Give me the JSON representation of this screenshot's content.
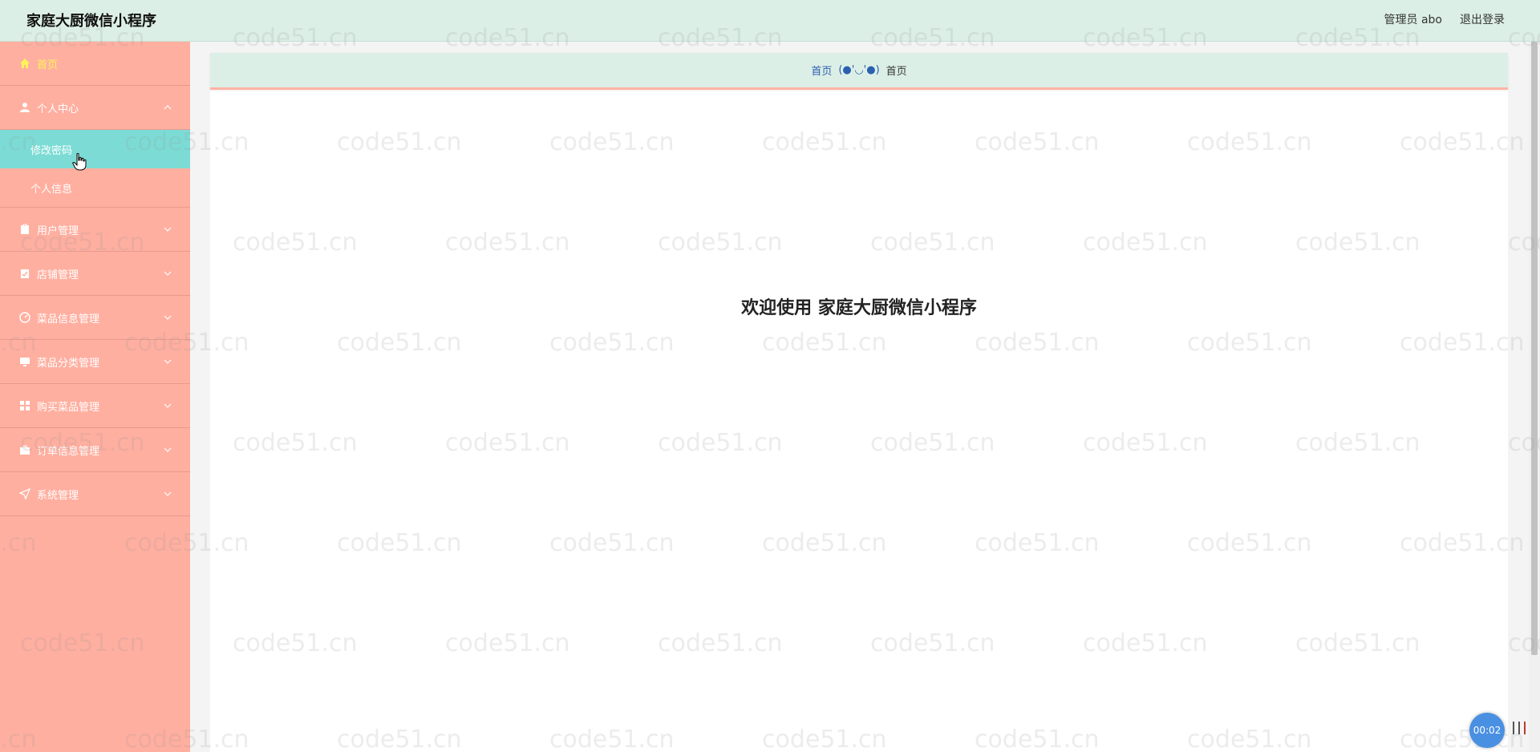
{
  "app": {
    "title": "家庭大厨微信小程序"
  },
  "header": {
    "user_label": "管理员 abo",
    "logout_label": "退出登录"
  },
  "sidebar": {
    "items": [
      {
        "label": "首页",
        "icon": "home-icon"
      },
      {
        "label": "个人中心",
        "icon": "user-icon",
        "expanded": true,
        "children": [
          {
            "label": "修改密码",
            "active": true
          },
          {
            "label": "个人信息"
          }
        ]
      },
      {
        "label": "用户管理",
        "icon": "clipboard-icon"
      },
      {
        "label": "店铺管理",
        "icon": "clipboard-check-icon"
      },
      {
        "label": "菜品信息管理",
        "icon": "dashboard-icon"
      },
      {
        "label": "菜品分类管理",
        "icon": "monitor-icon"
      },
      {
        "label": "购买菜品管理",
        "icon": "grid-icon"
      },
      {
        "label": "订单信息管理",
        "icon": "briefcase-icon"
      },
      {
        "label": "系统管理",
        "icon": "navigation-icon"
      }
    ]
  },
  "breadcrumb": {
    "home": "首页",
    "separator": "(●'◡'●)",
    "current": "首页"
  },
  "main": {
    "welcome": "欢迎使用 家庭大厨微信小程序"
  },
  "watermark": {
    "text": "code51.cn"
  },
  "recorder": {
    "time": "00:02"
  },
  "colors": {
    "header_bg": "#dcefe6",
    "sidebar_bg": "#ffafa0",
    "active_sub_bg": "#7cdcd5",
    "home_text": "#fff35a"
  }
}
